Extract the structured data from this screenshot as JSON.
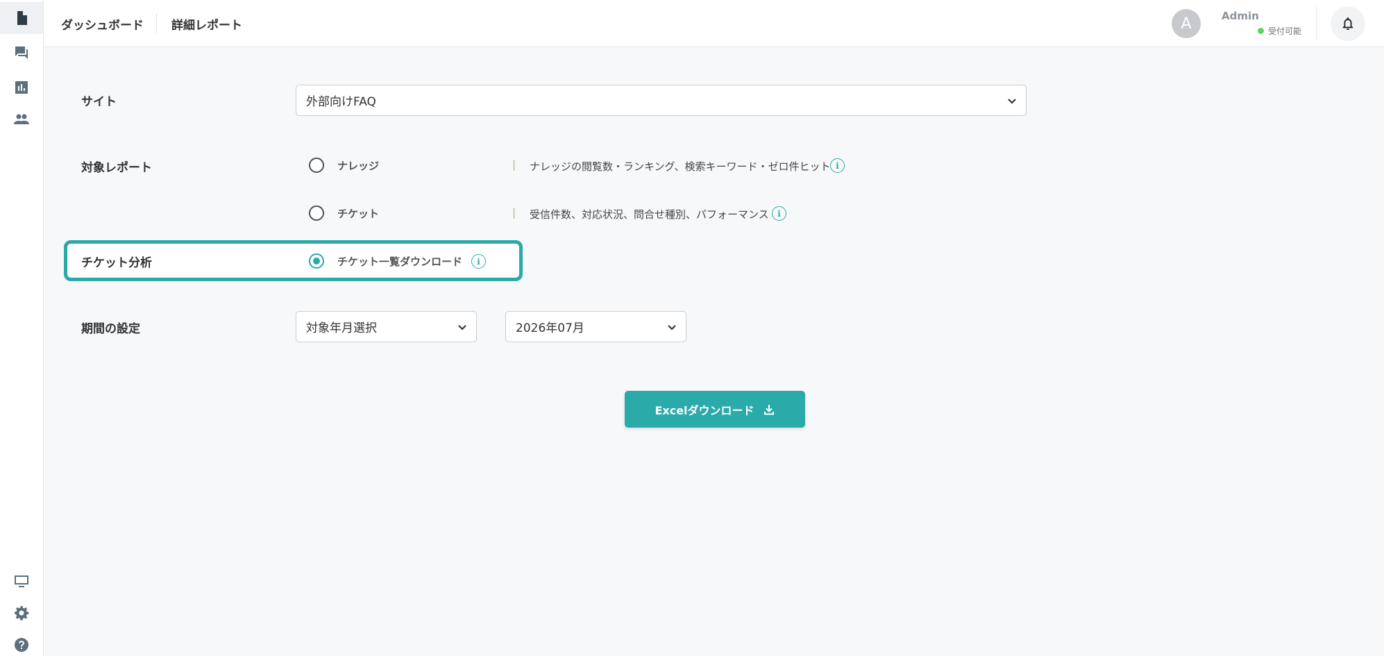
{
  "sidebar": {
    "items": [
      {
        "icon": "document-icon",
        "active": true
      },
      {
        "icon": "chat-icon",
        "active": false
      },
      {
        "icon": "bar-chart-icon",
        "active": false
      },
      {
        "icon": "people-icon",
        "active": false
      }
    ],
    "bottom_items": [
      {
        "icon": "monitor-icon"
      },
      {
        "icon": "gear-icon"
      },
      {
        "icon": "help-icon"
      }
    ]
  },
  "header": {
    "breadcrumb": [
      "ダッシュボード",
      "詳細レポート"
    ],
    "avatar_initial": "A",
    "user_name": "Admin",
    "status_text": "受付可能",
    "status_color": "#5fd35a"
  },
  "form": {
    "site": {
      "label": "サイト",
      "value": "外部向けFAQ"
    },
    "report": {
      "label": "対象レポート",
      "options": [
        {
          "label": "ナレッジ",
          "description": "ナレッジの閲覧数・ランキング、検索キーワード・ゼロ件ヒット",
          "checked": false
        },
        {
          "label": "チケット",
          "description": "受信件数、対応状況、問合せ種別、パフォーマンス",
          "checked": false
        }
      ],
      "separator": "|"
    },
    "ticket_analysis": {
      "label": "チケット分析",
      "option": {
        "label": "チケット一覧ダウンロード",
        "checked": true
      }
    },
    "period": {
      "label": "期間の設定",
      "mode": "対象年月選択",
      "month": "2026年07月"
    },
    "download_button": "Excelダウンロード"
  },
  "colors": {
    "accent": "#2baaaa",
    "highlight_border": "#2ba9a9"
  }
}
